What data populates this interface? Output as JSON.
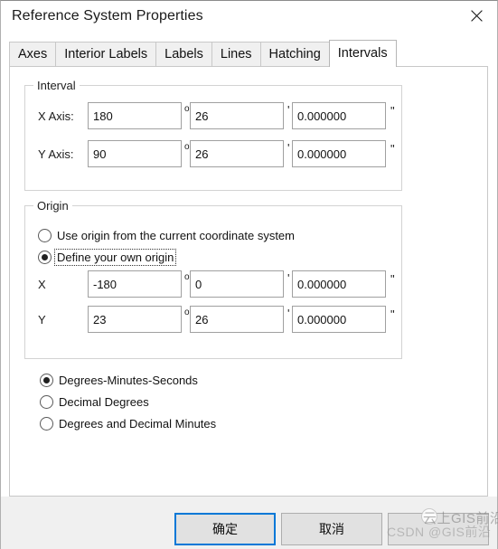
{
  "window": {
    "title": "Reference System Properties",
    "close_icon": "close-icon"
  },
  "tabs": [
    {
      "label": "Axes",
      "active": false
    },
    {
      "label": "Interior Labels",
      "active": false
    },
    {
      "label": "Labels",
      "active": false
    },
    {
      "label": "Lines",
      "active": false
    },
    {
      "label": "Hatching",
      "active": false
    },
    {
      "label": "Intervals",
      "active": true
    }
  ],
  "units": {
    "degrees": "o",
    "minutes": "'",
    "seconds": "\""
  },
  "interval": {
    "group_title": "Interval",
    "rows": [
      {
        "label": "X Axis:",
        "degrees": "180",
        "minutes": "26",
        "seconds": "0.000000"
      },
      {
        "label": "Y Axis:",
        "degrees": "90",
        "minutes": "26",
        "seconds": "0.000000"
      }
    ]
  },
  "origin": {
    "group_title": "Origin",
    "options": [
      {
        "label": "Use origin from the current coordinate system",
        "checked": false,
        "focused": false
      },
      {
        "label": "Define your own origin",
        "checked": true,
        "focused": true
      }
    ],
    "rows": [
      {
        "label": "X",
        "degrees": "-180",
        "minutes": "0",
        "seconds": "0.000000"
      },
      {
        "label": "Y",
        "degrees": "23",
        "minutes": "26",
        "seconds": "0.000000"
      }
    ]
  },
  "format": {
    "options": [
      {
        "label": "Degrees-Minutes-Seconds",
        "checked": true
      },
      {
        "label": "Decimal Degrees",
        "checked": false
      },
      {
        "label": "Degrees and Decimal Minutes",
        "checked": false
      }
    ]
  },
  "buttons": {
    "ok": "确定",
    "cancel": "取消",
    "extra": ""
  },
  "watermark": {
    "cn": "云上GIS前沿",
    "en": "CSDN @GIS前沿"
  },
  "colors": {
    "accent": "#0078d7",
    "dialog_bg": "#f0f0f0",
    "panel_bg": "#ffffff",
    "border": "#c8c8c8"
  }
}
